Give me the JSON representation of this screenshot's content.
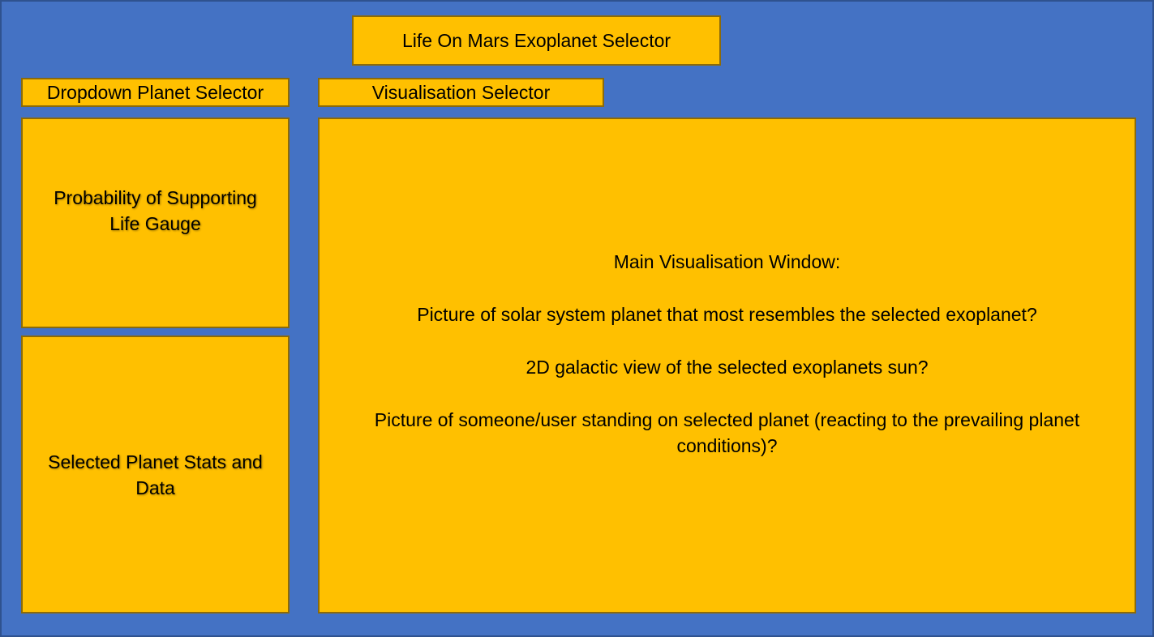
{
  "colors": {
    "background": "#4472C4",
    "panel": "#FFC000",
    "panel_border": "#8B6A0A"
  },
  "title": "Life On Mars Exoplanet Selector",
  "dropdown_selector": "Dropdown Planet Selector",
  "visualisation_selector": "Visualisation Selector",
  "gauge_panel": "Probability of Supporting Life Gauge",
  "stats_panel": "Selected Planet Stats and Data",
  "main_window": {
    "heading": "Main Visualisation Window:",
    "lines": [
      "Picture of solar system planet that most resembles the selected exoplanet?",
      "2D galactic view of the selected exoplanets sun?",
      "Picture of someone/user standing on selected planet (reacting to the prevailing planet conditions)?"
    ]
  }
}
